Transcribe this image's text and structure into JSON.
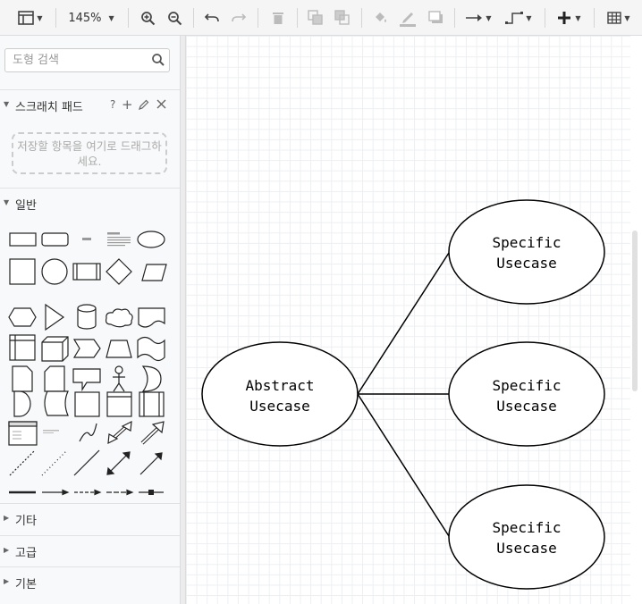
{
  "toolbar": {
    "zoom": "145%"
  },
  "sidebar": {
    "search_placeholder": "도형 검색",
    "scratchpad": {
      "title": "스크래치 패드",
      "help": "?",
      "drop_hint": "저장할 항목을 여기로 드래그하세요."
    },
    "general": {
      "title": "일반"
    },
    "sections": [
      {
        "title": "기타"
      },
      {
        "title": "고급"
      },
      {
        "title": "기본"
      }
    ]
  },
  "diagram": {
    "abstract": {
      "line1": "Abstract",
      "line2": "Usecase"
    },
    "specific": [
      {
        "line1": "Specific",
        "line2": "Usecase"
      },
      {
        "line1": "Specific",
        "line2": "Usecase"
      },
      {
        "line1": "Specific",
        "line2": "Usecase"
      }
    ]
  },
  "colors": {
    "toolbar_bg": "#f5f5f5",
    "sidebar_bg": "#f8f9fa",
    "grid": "#eceff2"
  }
}
